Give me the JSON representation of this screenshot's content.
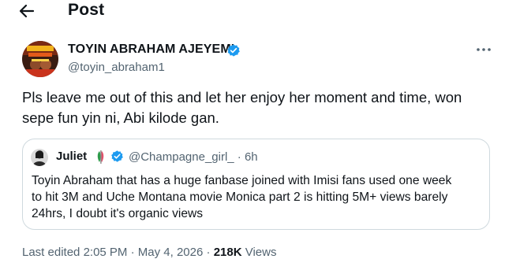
{
  "header": {
    "title": "Post"
  },
  "author": {
    "name": "TOYIN ABRAHAM AJEYEMI",
    "handle": "@toyin_abraham1"
  },
  "post": {
    "text_line1": "Pls leave me out of this and let her enjoy her moment and time, won",
    "text_line2": "sepe fun yin ni, Abi kilode gan."
  },
  "quoted": {
    "name": "Juliet",
    "handle_time": "@Champagne_girl_ · 6h",
    "lines": [
      "Toyin Abraham that has a huge fanbase joined with Imisi fans used one week",
      "to hit 3M and Uche Montana movie Monica part 2 is hitting  5M+ views barely",
      "24hrs, I doubt it's organic views"
    ]
  },
  "meta": {
    "edited_prefix": "Last edited ",
    "time": "2:05 PM",
    "sep": " · ",
    "date": "May 4, 2026",
    "views_count": "218K",
    "views_label": " Views"
  },
  "colors": {
    "verified": "#1d9bf0",
    "secondary_text": "#536471",
    "border": "#cfd9de"
  },
  "icons": [
    "back-arrow-icon",
    "verified-badge-icon",
    "more-icon",
    "flag-icon"
  ]
}
